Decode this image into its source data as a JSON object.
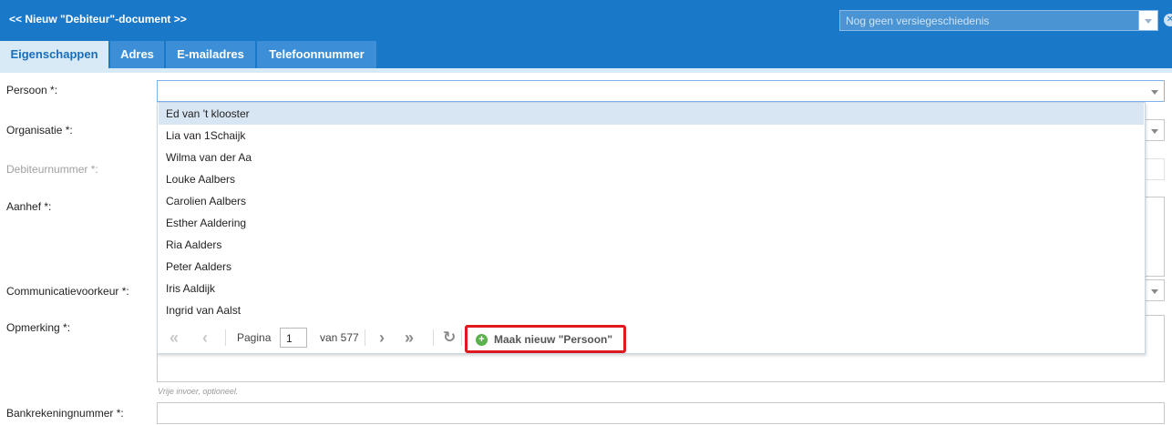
{
  "header": {
    "title": "<< Nieuw \"Debiteur\"-document >>",
    "version_placeholder": "Nog geen versiegeschiedenis"
  },
  "tabs": [
    {
      "label": "Eigenschappen",
      "active": true
    },
    {
      "label": "Adres",
      "active": false
    },
    {
      "label": "E-mailadres",
      "active": false
    },
    {
      "label": "Telefoonnummer",
      "active": false
    }
  ],
  "form": {
    "persoon_label": "Persoon *:",
    "organisatie_label": "Organisatie *:",
    "debiteurnummer_label": "Debiteurnummer *:",
    "aanhef_label": "Aanhef *:",
    "communicatie_label": "Communicatievoorkeur *:",
    "opmerking_label": "Opmerking *:",
    "opmerking_hint": "Vrije invoer, optioneel.",
    "bankrekening_label": "Bankrekeningnummer *:"
  },
  "dropdown": {
    "items": [
      "Ed van 't klooster",
      "Lia van 1Schaijk",
      "Wilma van der Aa",
      "Louke Aalbers",
      "Carolien Aalbers",
      "Esther Aaldering",
      "Ria Aalders",
      "Peter Aalders",
      "Iris Aaldijk",
      "Ingrid van Aalst"
    ],
    "selected_index": 0,
    "pager": {
      "page_label": "Pagina",
      "page_value": "1",
      "of_label": "van 577"
    },
    "new_button_label": "Maak nieuw \"Persoon\""
  },
  "colors": {
    "header_bg": "#1a78c8",
    "active_tab_bg": "#d9eaf7",
    "highlight_border": "#e0191e",
    "add_icon": "#5bb14a"
  }
}
